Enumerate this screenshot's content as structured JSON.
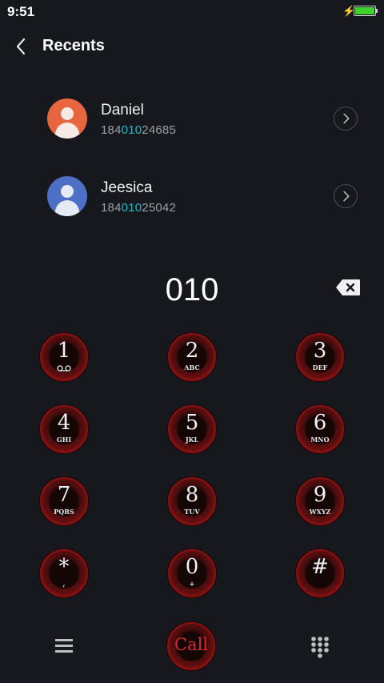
{
  "status_bar": {
    "time": "9:51",
    "battery_level": 1.0,
    "charging_icon": "charging-bolt-icon"
  },
  "header": {
    "title": "Recents",
    "back_icon": "back-arrow-icon"
  },
  "recents": [
    {
      "name": "Daniel",
      "number_prefix": "184",
      "number_match": "010",
      "number_suffix": "24685",
      "avatar_color": "#e8663f"
    },
    {
      "name": "Jeesica",
      "number_prefix": "184",
      "number_match": "010",
      "number_suffix": "25042",
      "avatar_color": "#4e6fc6"
    }
  ],
  "dial_display": "010",
  "keypad": [
    {
      "digit": "1",
      "letters": ""
    },
    {
      "digit": "2",
      "letters": "ABC"
    },
    {
      "digit": "3",
      "letters": "DEF"
    },
    {
      "digit": "4",
      "letters": "GHI"
    },
    {
      "digit": "5",
      "letters": "JKL"
    },
    {
      "digit": "6",
      "letters": "MNO"
    },
    {
      "digit": "7",
      "letters": "PQRS"
    },
    {
      "digit": "8",
      "letters": "TUV"
    },
    {
      "digit": "9",
      "letters": "WXYZ"
    },
    {
      "digit": "*",
      "letters": ","
    },
    {
      "digit": "0",
      "letters": "+"
    },
    {
      "digit": "#",
      "letters": ""
    }
  ],
  "bottom_bar": {
    "call_label": "Call",
    "menu_icon": "menu-icon",
    "dialpad_icon": "dialpad-icon"
  },
  "colors": {
    "background": "#16181d",
    "accent_match": "#1fb8c8",
    "call_text": "#e0262d",
    "key_red": "#8e1010"
  }
}
